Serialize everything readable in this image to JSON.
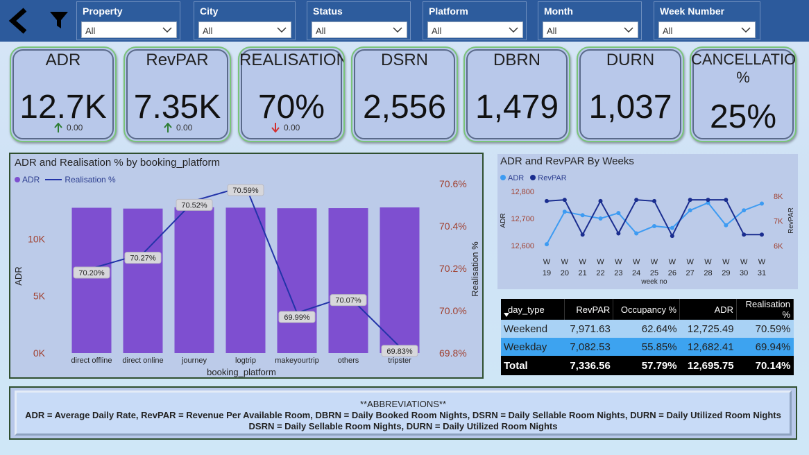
{
  "slicers": [
    {
      "label": "Property",
      "value": "All"
    },
    {
      "label": "City",
      "value": "All"
    },
    {
      "label": "Status",
      "value": "All"
    },
    {
      "label": "Platform",
      "value": "All"
    },
    {
      "label": "Month",
      "value": "All"
    },
    {
      "label": "Week Number",
      "value": "All"
    }
  ],
  "kpis": [
    {
      "title": "ADR",
      "value": "12.7K",
      "delta": "0.00",
      "trend": "up"
    },
    {
      "title": "RevPAR",
      "value": "7.35K",
      "delta": "0.00",
      "trend": "up"
    },
    {
      "title": "REALISATION%",
      "value": "70%",
      "delta": "0.00",
      "trend": "down"
    },
    {
      "title": "DSRN",
      "value": "2,556"
    },
    {
      "title": "DBRN",
      "value": "1,479"
    },
    {
      "title": "DURN",
      "value": "1,037"
    },
    {
      "title": "CANCELLATION %",
      "value": "25%"
    }
  ],
  "colors": {
    "bar": "#7e4fd0",
    "line": "#2233a8",
    "adr_weeks": "#3d9bf2",
    "revpar_weeks": "#1a2d8f",
    "axis_red": "#a0402f",
    "up": "#2e7d32",
    "down": "#d32f2f"
  },
  "platform_chart": {
    "title": "ADR and Realisation % by booking_platform",
    "legend_adr": "ADR",
    "legend_real": "Realisation %",
    "xlabel": "booking_platform",
    "ylabel_left": "ADR",
    "ylabel_right": "Realisation %"
  },
  "weeks_chart": {
    "title": "ADR and RevPAR By Weeks",
    "legend_adr": "ADR",
    "legend_revpar": "RevPAR",
    "xlabel": "week no",
    "ylabel_left": "ADR",
    "ylabel_right": "RevPAR"
  },
  "chart_data": [
    {
      "type": "bar",
      "title": "ADR and Realisation % by booking_platform",
      "categories": [
        "direct offline",
        "direct online",
        "journey",
        "logtrip",
        "makeyourtrip",
        "others",
        "tripster"
      ],
      "series": [
        {
          "name": "ADR",
          "type": "bar",
          "axis": "left",
          "values": [
            12720,
            12650,
            12760,
            12730,
            12680,
            12690,
            12750
          ]
        },
        {
          "name": "Realisation %",
          "type": "line",
          "axis": "right",
          "values": [
            70.2,
            70.27,
            70.52,
            70.59,
            69.99,
            70.07,
            69.83
          ],
          "labels": [
            "70.20%",
            "70.27%",
            "70.52%",
            "70.59%",
            "69.99%",
            "70.07%",
            "69.83%"
          ]
        }
      ],
      "xlabel": "booking_platform",
      "ylabel": "ADR",
      "y2label": "Realisation %",
      "ylim": [
        0,
        15000
      ],
      "yticks": [
        "0K",
        "5K",
        "10K"
      ],
      "y2lim": [
        69.8,
        70.6
      ],
      "y2ticks": [
        "69.8%",
        "70.0%",
        "70.2%",
        "70.4%",
        "70.6%"
      ],
      "legend": "top-left"
    },
    {
      "type": "line",
      "title": "ADR and RevPAR By Weeks",
      "categories": [
        "W 19",
        "W 20",
        "W 21",
        "W 22",
        "W 23",
        "W 24",
        "W 25",
        "W 26",
        "W 27",
        "W 28",
        "W 29",
        "W 30",
        "W 31"
      ],
      "series": [
        {
          "name": "ADR",
          "axis": "left",
          "values": [
            12605,
            12725,
            12712,
            12700,
            12720,
            12645,
            12672,
            12665,
            12730,
            12758,
            12675,
            12730,
            12755
          ]
        },
        {
          "name": "RevPAR",
          "axis": "right",
          "values": [
            7800,
            7850,
            6450,
            7800,
            6500,
            7850,
            7800,
            6400,
            7850,
            7850,
            7850,
            6450,
            6450
          ]
        }
      ],
      "xlabel": "week no",
      "ylabel": "ADR",
      "y2label": "RevPAR",
      "ylim": [
        12590,
        12810
      ],
      "yticks": [
        "12,600",
        "12,700",
        "12,800"
      ],
      "y2lim": [
        5900,
        8300
      ],
      "y2ticks": [
        "6K",
        "7K",
        "8K"
      ],
      "legend": "top-left"
    }
  ],
  "table": {
    "headers": [
      "day_type",
      "RevPAR",
      "Occupancy %",
      "ADR",
      "Realisation %"
    ],
    "rows": [
      [
        "Weekend",
        "7,971.63",
        "62.64%",
        "12,725.49",
        "70.59%"
      ],
      [
        "Weekday",
        "7,082.53",
        "55.85%",
        "12,682.41",
        "69.94%"
      ]
    ],
    "total": [
      "Total",
      "7,336.56",
      "57.79%",
      "12,695.75",
      "70.14%"
    ]
  },
  "abbreviations": {
    "heading": "**ABBREVIATIONS**",
    "line1": "ADR = Average Daily Rate, RevPAR = Revenue Per Available Room,   DBRN = Daily Booked Room Nights,   DSRN = Daily Sellable Room Nights,   DURN = Daily Utilized Room Nights",
    "line2": "DSRN = Daily Sellable Room Nights,   DURN = Daily Utilized Room Nights"
  }
}
